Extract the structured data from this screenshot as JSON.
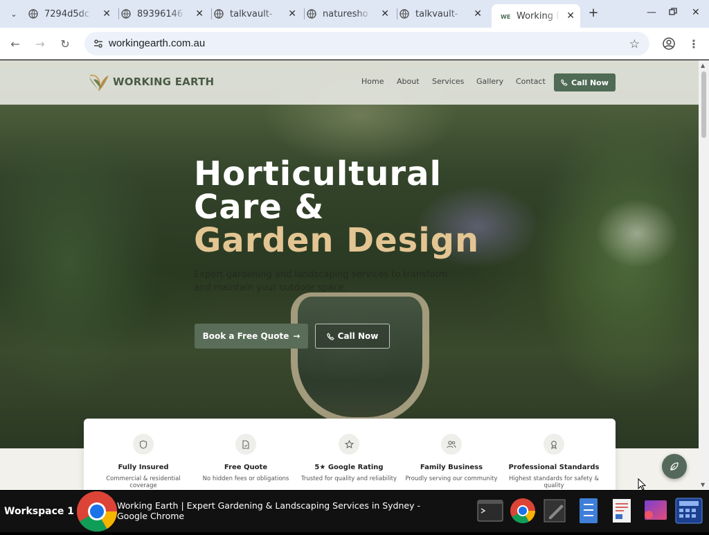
{
  "browser": {
    "tabs": [
      {
        "title": "7294d5dc",
        "active": false
      },
      {
        "title": "89396146",
        "active": false
      },
      {
        "title": "talkvault-",
        "active": false
      },
      {
        "title": "naturesho",
        "active": false
      },
      {
        "title": "talkvault-",
        "active": false
      },
      {
        "title": "Working E",
        "active": true
      }
    ],
    "url": "workingearth.com.au"
  },
  "site": {
    "logo_text": "WORKING EARTH",
    "nav": [
      "Home",
      "About",
      "Services",
      "Gallery",
      "Contact"
    ],
    "nav_cta": "Call Now",
    "hero": {
      "title_line1": "Horticultural",
      "title_line2": "Care &",
      "title_line3": "Garden Design",
      "subtitle": "Expert gardening and landscaping services to transform and maintain your outdoor space.",
      "btn_quote": "Book a Free Quote",
      "btn_call": "Call Now"
    },
    "features": [
      {
        "icon": "shield-icon",
        "title": "Fully Insured",
        "desc": "Commercial & residential coverage"
      },
      {
        "icon": "document-icon",
        "title": "Free Quote",
        "desc": "No hidden fees or obligations"
      },
      {
        "icon": "star-icon",
        "title": "5★ Google Rating",
        "desc": "Trusted for quality and reliability"
      },
      {
        "icon": "users-icon",
        "title": "Family Business",
        "desc": "Proudly serving our community"
      },
      {
        "icon": "award-icon",
        "title": "Professional Standards",
        "desc": "Highest standards for safety & quality"
      }
    ],
    "colors": {
      "accent": "#e3c593",
      "brand": "#4f6b55"
    }
  },
  "taskbar": {
    "workspace": "Workspace 1",
    "window_title": "Working Earth | Expert Gardening & Landscaping Services in Sydney - Google Chrome"
  }
}
